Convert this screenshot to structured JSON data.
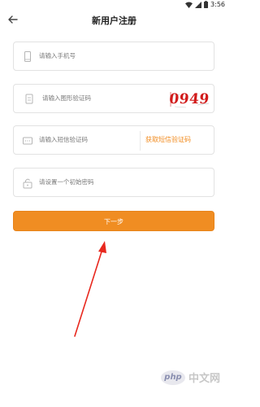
{
  "status_bar": {
    "time": "3:56"
  },
  "header": {
    "title": "新用户注册"
  },
  "form": {
    "phone_placeholder": "请输入手机号",
    "image_code_placeholder": "请输入图形验证码",
    "captcha_text": "0949",
    "sms_code_placeholder": "请输入短信验证码",
    "get_sms_label": "获取短信验证码",
    "password_placeholder": "请设置一个初始密码",
    "next_label": "下一步"
  },
  "watermark": {
    "logo": "php",
    "text": "中文网"
  },
  "colors": {
    "accent": "#f08d22",
    "captcha": "#d11a1a",
    "arrow": "#e8281e"
  },
  "icons": [
    "wifi-icon",
    "signal-icon",
    "battery-icon",
    "back-arrow-icon",
    "phone-icon",
    "image-code-icon",
    "sms-icon",
    "lock-icon"
  ]
}
